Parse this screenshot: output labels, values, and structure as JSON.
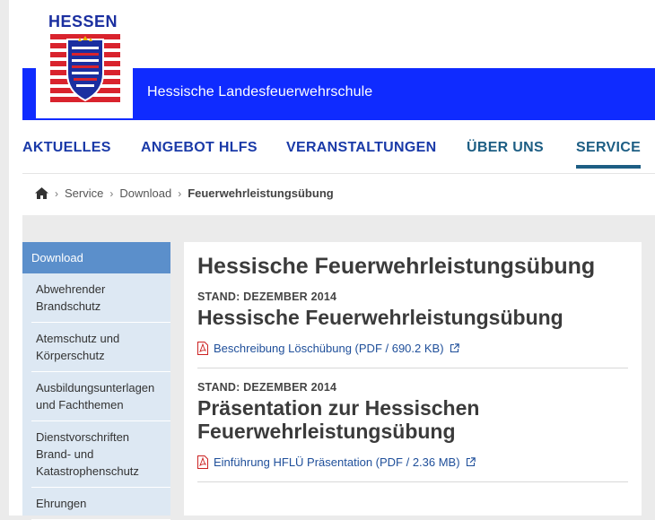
{
  "header": {
    "logo_word": "HESSEN",
    "site_name": "Hessische Landesfeuerwehrschule"
  },
  "nav": {
    "items": [
      {
        "label": "AKTUELLES"
      },
      {
        "label": "ANGEBOT HLFS"
      },
      {
        "label": "VERANSTALTUNGEN"
      },
      {
        "label": "ÜBER UNS"
      },
      {
        "label": "SERVICE"
      }
    ]
  },
  "breadcrumb": {
    "home_icon": "home-icon",
    "items": [
      "Service",
      "Download",
      "Feuerwehrleistungsübung"
    ]
  },
  "sidebar": {
    "heading": "Download",
    "items": [
      {
        "line1": "Abwehrender",
        "line2": "Brandschutz"
      },
      {
        "line1": "Atemschutz und",
        "line2": "Körperschutz"
      },
      {
        "line1": "Ausbildungsunterlagen",
        "line2": "und Fachthemen"
      },
      {
        "line1": "Dienstvorschriften",
        "line2": "Brand- und",
        "line3": "Katastrophenschutz"
      },
      {
        "line1": "Ehrungen"
      }
    ]
  },
  "main": {
    "title": "Hessische Feuerwehrleistungsübung",
    "sections": [
      {
        "stand": "STAND: DEZEMBER 2014",
        "heading_line1": "Hessische Feuerwehrleistungsübung",
        "link": "Beschreibung Löschübung (PDF / 690.2 KB)"
      },
      {
        "stand": "STAND: DEZEMBER 2014",
        "heading_line1": "Präsentation zur Hessischen",
        "heading_line2": "Feuerwehrleistungsübung",
        "link": "Einführung HFLÜ Präsentation (PDF / 2.36 MB)"
      }
    ]
  },
  "colors": {
    "header_blue": "#0f2bff",
    "nav_blue": "#1a3aa8",
    "nav_active": "#1d5e84",
    "sidebar_head": "#5b8fcb",
    "sidebar_bg": "#dde8f3"
  }
}
